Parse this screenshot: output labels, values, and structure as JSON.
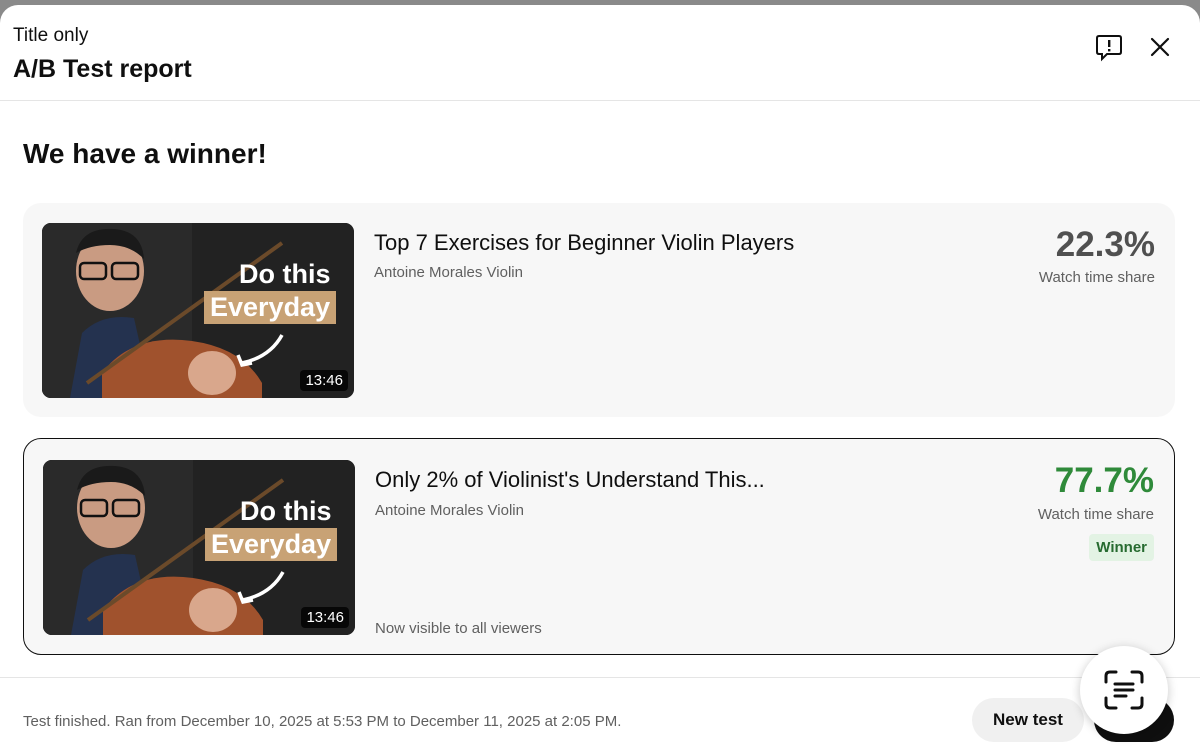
{
  "header": {
    "subtitle": "Title only",
    "title": "A/B Test report",
    "feedback_icon": "feedback-icon",
    "close_icon": "close-icon"
  },
  "heading": "We have a winner!",
  "variants": [
    {
      "thumbnail": {
        "line1": "Do this",
        "line2": "Everyday",
        "duration": "13:46"
      },
      "title": "Top 7 Exercises for Beginner Violin Players",
      "channel": "Antoine Morales Violin",
      "metric_value": "22.3%",
      "metric_label": "Watch time share",
      "watch_time_share": 22.3
    },
    {
      "thumbnail": {
        "line1": "Do this",
        "line2": "Everyday",
        "duration": "13:46"
      },
      "title": "Only 2% of Violinist's Understand This...",
      "channel": "Antoine Morales Violin",
      "metric_value": "77.7%",
      "metric_label": "Watch time share",
      "watch_time_share": 77.7,
      "badge": "Winner",
      "note": "Now visible to all viewers"
    }
  ],
  "footer": {
    "status_text": "Test finished. Ran from December 10, 2025 at 5:53 PM to December 11, 2025 at 2:05 PM.",
    "new_test_label": "New test"
  },
  "colors": {
    "winner_green": "#2f8a3a",
    "badge_bg": "#e3f3e4",
    "thumb_accent": "#c8a275"
  }
}
